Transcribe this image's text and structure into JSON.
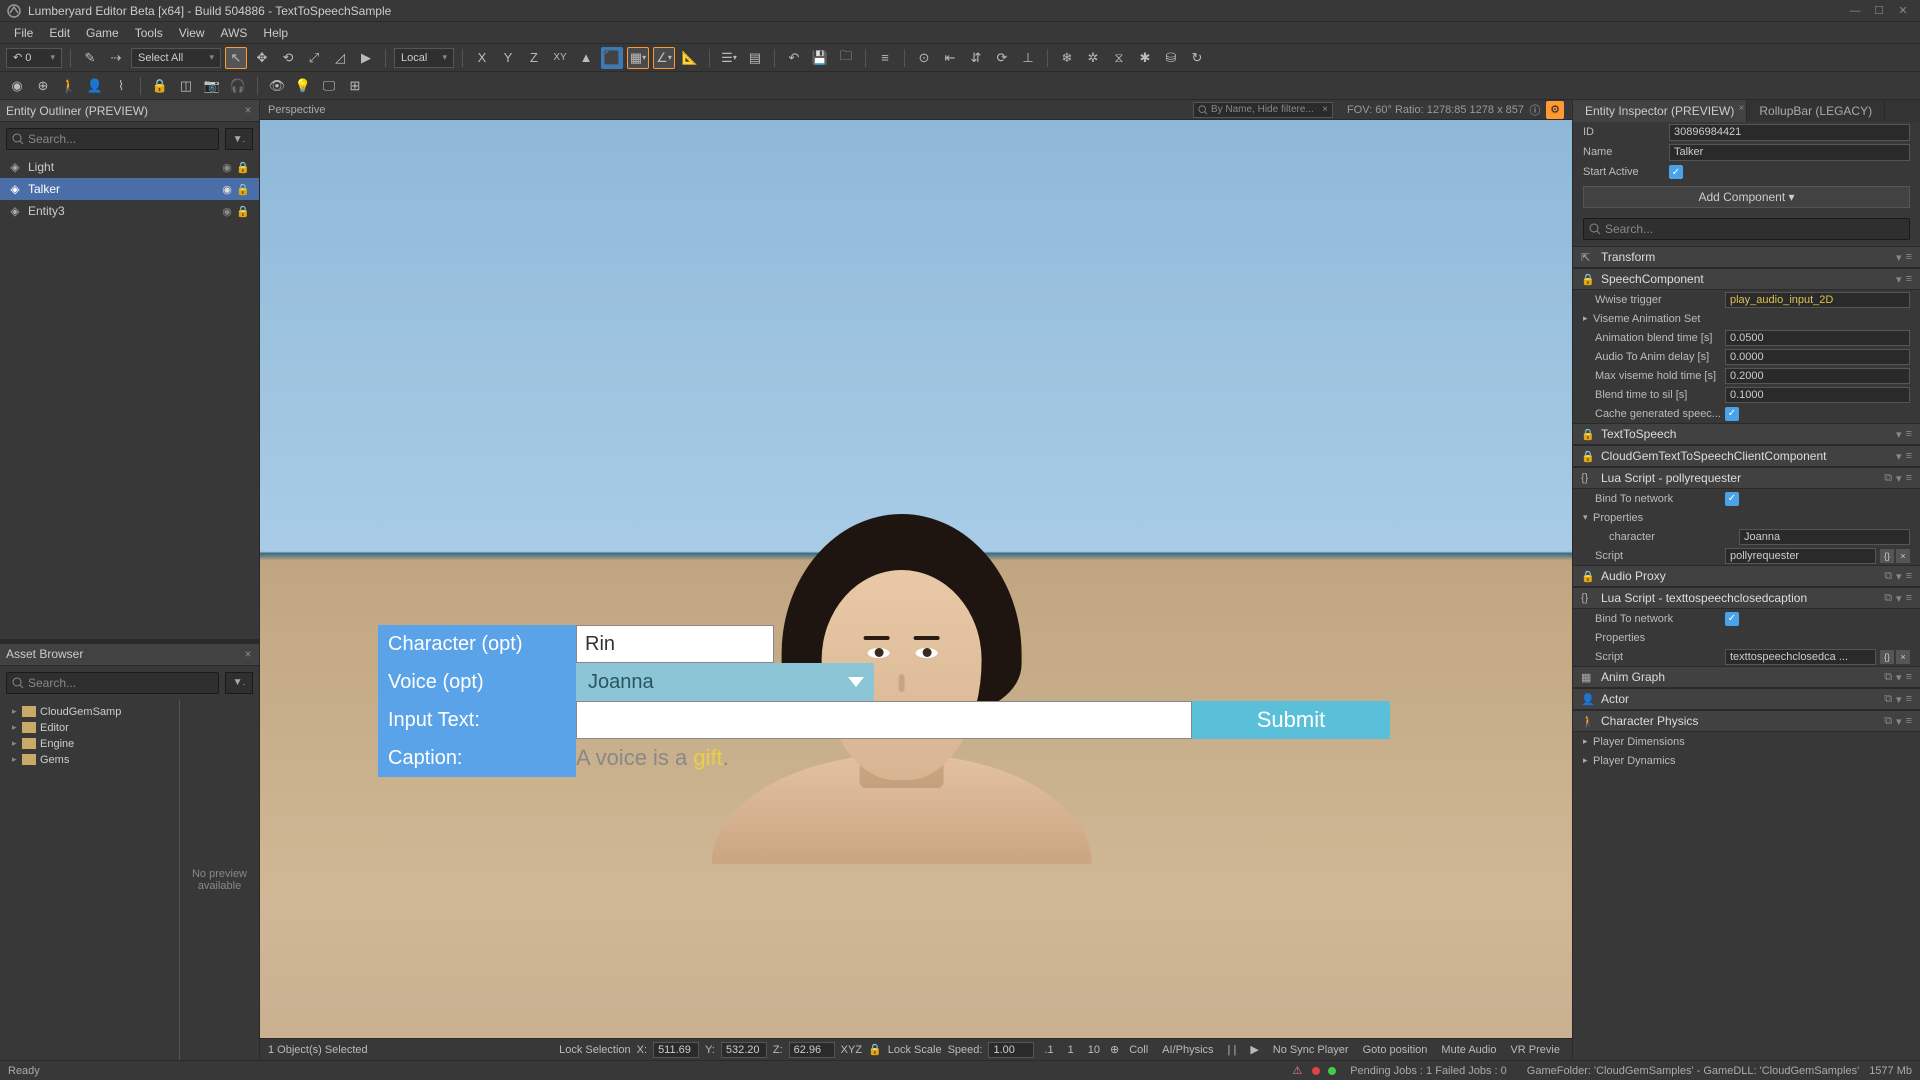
{
  "title": "Lumberyard Editor Beta [x64] - Build 504886 - TextToSpeechSample",
  "menu": [
    "File",
    "Edit",
    "Game",
    "Tools",
    "View",
    "AWS",
    "Help"
  ],
  "toolbar1": {
    "selectAll": "Select All",
    "local": "Local"
  },
  "leftPanel": {
    "title": "Entity Outliner (PREVIEW)",
    "search": "Search...",
    "items": [
      {
        "name": "Light",
        "selected": false
      },
      {
        "name": "Talker",
        "selected": true
      },
      {
        "name": "Entity3",
        "selected": false
      }
    ]
  },
  "assetBrowser": {
    "title": "Asset Browser",
    "search": "Search...",
    "tree": [
      "CloudGemSamp",
      "Editor",
      "Engine",
      "Gems"
    ],
    "preview": "No preview available"
  },
  "viewport": {
    "label": "Perspective",
    "searchPlaceholder": "By Name, Hide filtere...",
    "fov": "FOV: 60°  Ratio:   1278:85  1278 x 857"
  },
  "overlay": {
    "characterLabel": "Character (opt)",
    "characterValue": "Rin",
    "voiceLabel": "Voice (opt)",
    "voiceValue": "Joanna",
    "inputLabel": "Input Text:",
    "inputValue": "",
    "submit": "Submit",
    "captionLabel": "Caption:",
    "captionPre": "A voice is a ",
    "captionGift": "gift",
    "captionPost": "."
  },
  "vpBottom": {
    "selected": "1 Object(s) Selected",
    "lockSel": "Lock Selection",
    "x": "511.69",
    "y": "532.20",
    "z": "62.96",
    "xyz": "XYZ",
    "lockScale": "Lock Scale",
    "speed": "Speed:",
    "speedVal": "1.00",
    "steps": [
      ".1",
      "1",
      "10"
    ],
    "toggles": [
      "Coll",
      "AI/Physics",
      "| |",
      "▶",
      "No Sync Player",
      "Goto position",
      "Mute Audio",
      "VR Previe"
    ]
  },
  "inspector": {
    "tab1": "Entity Inspector (PREVIEW)",
    "tab2": "RollupBar (LEGACY)",
    "idLabel": "ID",
    "idVal": "30896984421",
    "nameLabel": "Name",
    "nameVal": "Talker",
    "startActive": "Start Active",
    "addComponent": "Add Component ▾",
    "search": "Search...",
    "comps": {
      "transform": "Transform",
      "speech": {
        "title": "SpeechComponent",
        "wwise": "Wwise trigger",
        "wwiseVal": "play_audio_input_2D",
        "viseme": "Viseme Animation Set",
        "blend": "Animation blend time [s]",
        "blendVal": "0.0500",
        "delay": "Audio To Anim delay [s]",
        "delayVal": "0.0000",
        "hold": "Max viseme hold time [s]",
        "holdVal": "0.2000",
        "sil": "Blend time to sil [s]",
        "silVal": "0.1000",
        "cache": "Cache generated speec..."
      },
      "tts": "TextToSpeech",
      "cloud": "CloudGemTextToSpeechClientComponent",
      "lua1": {
        "title": "Lua Script - pollyrequester",
        "bind": "Bind To network",
        "props": "Properties",
        "char": "character",
        "charVal": "Joanna",
        "script": "Script",
        "scriptVal": "pollyrequester"
      },
      "audioProxy": "Audio Proxy",
      "lua2": {
        "title": "Lua Script - texttospeechclosedcaption",
        "bind": "Bind To network",
        "props": "Properties",
        "script": "Script",
        "scriptVal": "texttospeechclosedca ..."
      },
      "anim": "Anim Graph",
      "actor": "Actor",
      "phys": "Character Physics",
      "pdim": "Player Dimensions",
      "pdyn": "Player Dynamics"
    }
  },
  "status": {
    "ready": "Ready",
    "jobs": "Pending Jobs : 1   Failed Jobs : 0",
    "folder": "GameFolder: 'CloudGemSamples' - GameDLL: 'CloudGemSamples'",
    "mem": "1577 Mb"
  }
}
